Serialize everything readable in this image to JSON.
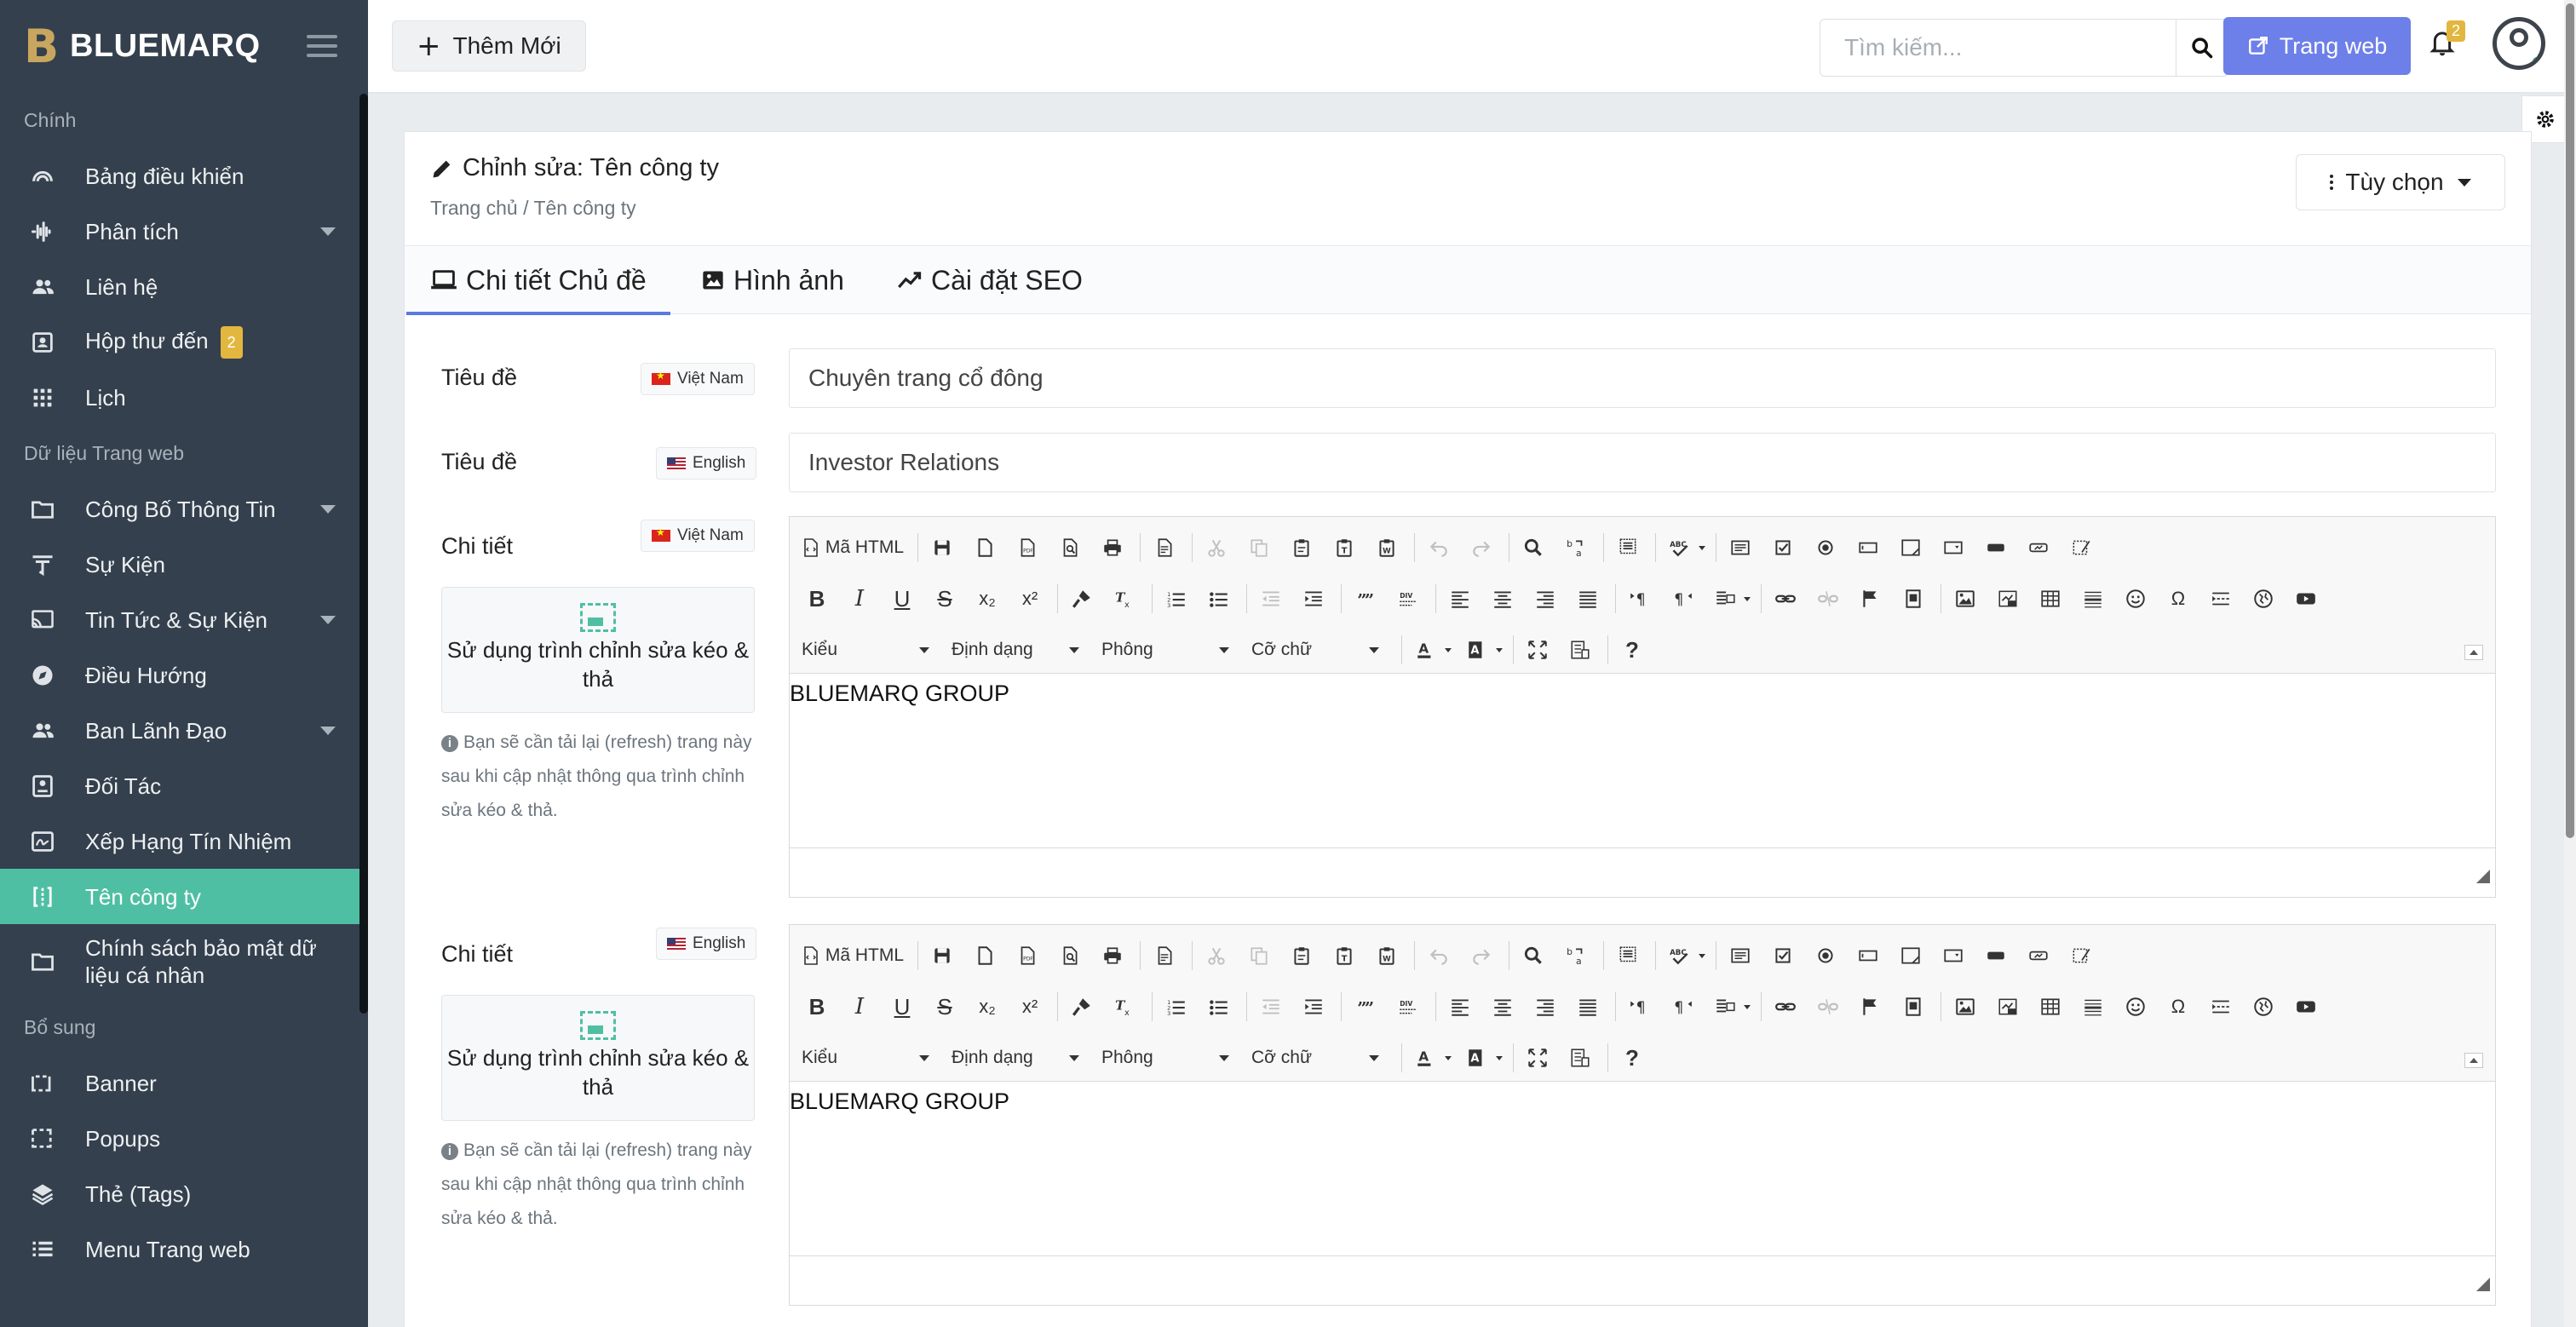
{
  "brand": {
    "mark": "B",
    "name": "BLUEMARQ"
  },
  "sidebar": {
    "sections": [
      {
        "title": "Chính",
        "items": [
          {
            "label": "Bảng điều khiển",
            "icon": "gauge-icon"
          },
          {
            "label": "Phân tích",
            "icon": "waveform-icon",
            "caret": true
          },
          {
            "label": "Liên hệ",
            "icon": "users-icon"
          },
          {
            "label": "Hộp thư đến",
            "icon": "inbox-icon",
            "badge": "2"
          },
          {
            "label": "Lịch",
            "icon": "grid-icon"
          }
        ]
      },
      {
        "title": "Dữ liệu Trang web",
        "items": [
          {
            "label": "Công Bố Thông Tin",
            "icon": "folder-icon",
            "caret": true
          },
          {
            "label": "Sự Kiện",
            "icon": "filter-icon"
          },
          {
            "label": "Tin Tức & Sự Kiện",
            "icon": "rss-icon",
            "caret": true
          },
          {
            "label": "Điều Hướng",
            "icon": "compass-icon"
          },
          {
            "label": "Ban Lãnh Đạo",
            "icon": "users-icon",
            "caret": true
          },
          {
            "label": "Đối Tác",
            "icon": "contact-icon"
          },
          {
            "label": "Xếp Hạng Tín Nhiệm",
            "icon": "signature-icon"
          },
          {
            "label": "Tên công ty",
            "icon": "column-icon",
            "active": true
          },
          {
            "label": "Chính sách bảo mật dữ liệu cá nhân",
            "icon": "folder-icon"
          }
        ]
      },
      {
        "title": "Bổ sung",
        "items": [
          {
            "label": "Banner",
            "icon": "banner-icon"
          },
          {
            "label": "Popups",
            "icon": "popup-icon"
          },
          {
            "label": "Thẻ (Tags)",
            "icon": "layers-icon"
          },
          {
            "label": "Menu Trang web",
            "icon": "list-icon"
          }
        ]
      }
    ]
  },
  "topbar": {
    "new_label": "Thêm Mới",
    "search_placeholder": "Tìm kiếm...",
    "web_label": "Trang web",
    "notif_count": "2"
  },
  "page": {
    "title": "Chỉnh sửa: Tên công ty",
    "breadcrumb": "Trang chủ / Tên công ty",
    "options_label": "Tùy chọn",
    "tabs": [
      "Chi tiết Chủ đề",
      "Hình ảnh",
      "Cài đặt SEO"
    ]
  },
  "form": {
    "title_label": "Tiêu đề",
    "detail_label": "Chi tiết",
    "lang_vn": "Việt Nam",
    "lang_en": "English",
    "title_vn": "Chuyên trang cổ đông",
    "title_en": "Investor Relations",
    "dnd_label": "Sử dụng trình chỉnh sửa kéo & thả",
    "note": "Bạn sẽ cần tải lại (refresh) trang này sau khi cập nhật thông qua trình chỉnh sửa kéo & thả.",
    "content_vn": "BLUEMARQ GROUP",
    "content_en": "BLUEMARQ GROUP"
  },
  "editor": {
    "source_label": "Mã HTML",
    "combos": [
      "Kiểu",
      "Định dạng",
      "Phông",
      "Cỡ chữ"
    ],
    "glyphs": {
      "bold": "B",
      "italic": "I",
      "underline": "U",
      "strike": "S",
      "sub": "x₂",
      "sup": "x²",
      "clear": "Tx",
      "quote": "99",
      "omega": "Ω",
      "help": "?",
      "spell": "ABC",
      "div": "DIV"
    }
  },
  "colors": {
    "sidebar": "#34404d",
    "active": "#4fbfa3",
    "primary": "#6d7fe8",
    "badge": "#e2b63f"
  }
}
